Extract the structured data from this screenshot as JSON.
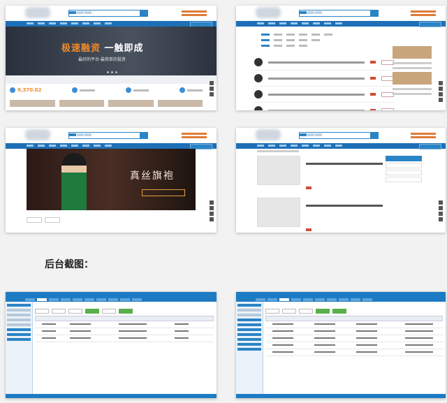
{
  "caption": "后台截图：",
  "shot1": {
    "banner_title_accent": "极速融资",
    "banner_title_rest": "一触即成",
    "banner_subtitle": "最好的平台·最简单的投资",
    "stat_amount": "9,370.02"
  },
  "shot3": {
    "banner_title": "真丝旗袍"
  },
  "colors": {
    "nav_blue": "#1d6fb6",
    "accent_orange": "#f08a2b",
    "tag_red": "#d24b3a",
    "admin_blue": "#1d7bc4"
  }
}
